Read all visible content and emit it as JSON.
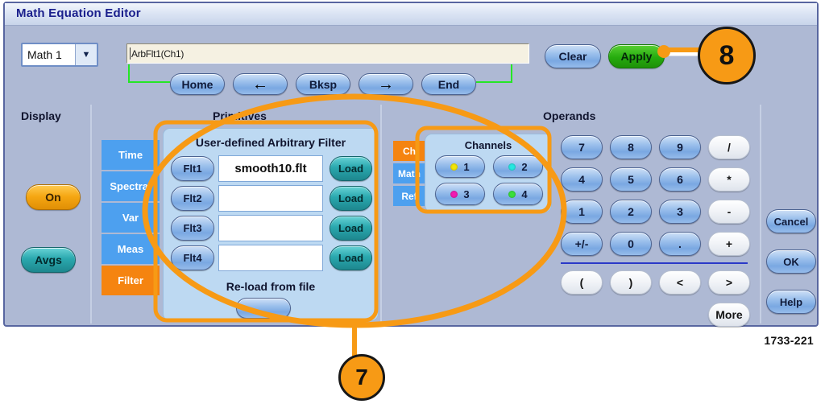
{
  "window": {
    "title": "Math Equation Editor"
  },
  "toolbar": {
    "math_select": {
      "value": "Math 1",
      "arrow_icon": "chevron-down-icon"
    },
    "equation_field": {
      "value": "ArbFlt1(Ch1)",
      "placeholder": ""
    },
    "nav_buttons": [
      {
        "id": "home",
        "label": "Home"
      },
      {
        "id": "left",
        "label": "←"
      },
      {
        "id": "bksp",
        "label": "Bksp"
      },
      {
        "id": "right",
        "label": "→"
      },
      {
        "id": "end",
        "label": "End"
      }
    ],
    "clear_label": "Clear",
    "apply_label": "Apply"
  },
  "display": {
    "heading": "Display",
    "on_label": "On",
    "avgs_label": "Avgs"
  },
  "primitives": {
    "heading": "Primitives",
    "tabs": [
      {
        "label": "Time",
        "selected": false
      },
      {
        "label": "Spectral",
        "selected": false
      },
      {
        "label": "Var",
        "selected": false
      },
      {
        "label": "Meas",
        "selected": false
      },
      {
        "label": "Filter",
        "selected": true
      }
    ],
    "filter_panel": {
      "title": "User-defined  Arbitrary Filter",
      "rows": [
        {
          "button": "Flt1",
          "value": "smooth10.flt",
          "load": "Load"
        },
        {
          "button": "Flt2",
          "value": "",
          "load": "Load"
        },
        {
          "button": "Flt3",
          "value": "",
          "load": "Load"
        },
        {
          "button": "Flt4",
          "value": "",
          "load": "Load"
        }
      ],
      "reload_label": "Re-load from file"
    }
  },
  "operands": {
    "heading": "Operands",
    "source_tabs": [
      {
        "label": "Ch",
        "selected": true
      },
      {
        "label": "Math",
        "selected": false
      },
      {
        "label": "Ref",
        "selected": false
      }
    ],
    "channels": {
      "title": "Channels",
      "items": [
        {
          "label": "1",
          "color": "#f2e50a"
        },
        {
          "label": "2",
          "color": "#24e8e0"
        },
        {
          "label": "3",
          "color": "#f21ab2"
        },
        {
          "label": "4",
          "color": "#3ae03a"
        }
      ]
    },
    "keypad": {
      "rows": [
        [
          "7",
          "8",
          "9",
          "/"
        ],
        [
          "4",
          "5",
          "6",
          "*"
        ],
        [
          "1",
          "2",
          "3",
          "-"
        ],
        [
          "+/-",
          "0",
          ".",
          "+"
        ]
      ],
      "extra_row": [
        "(",
        ")",
        "<",
        ">"
      ],
      "more_label": "More"
    }
  },
  "actions": {
    "cancel_label": "Cancel",
    "ok_label": "OK",
    "help_label": "Help"
  },
  "annotations": {
    "callout_7": "7",
    "callout_8": "8",
    "figure_number": "1733-221",
    "highlight_color": "#f79a15"
  }
}
